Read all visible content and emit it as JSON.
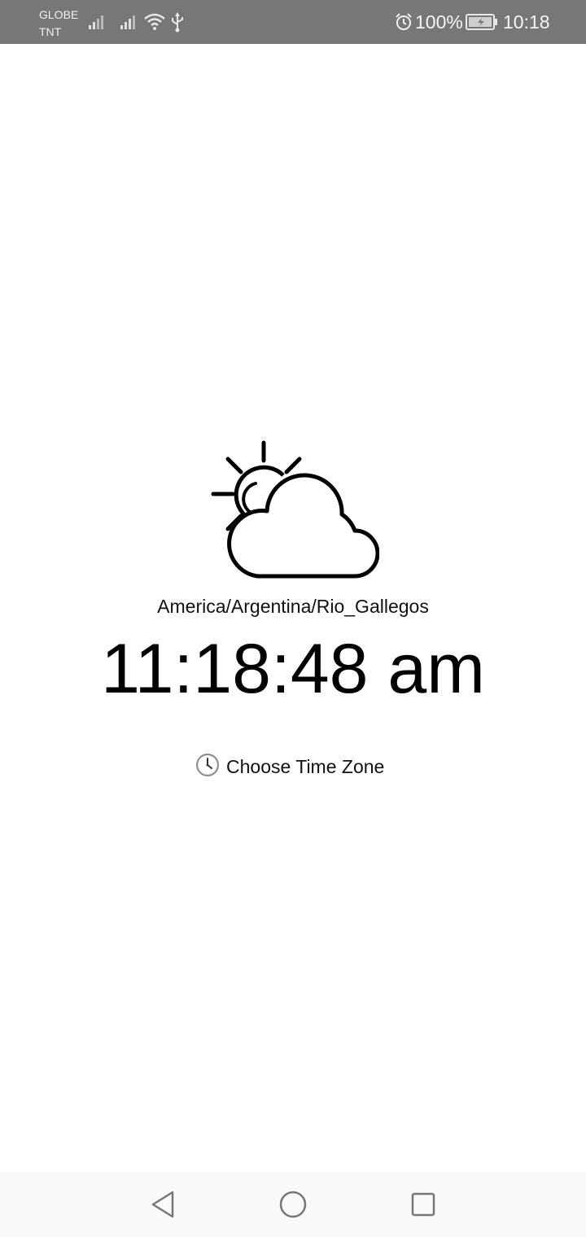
{
  "status_bar": {
    "carrier_line1": "GLOBE",
    "carrier_line2": "TNT",
    "icons": [
      "signal-icon",
      "signal-icon",
      "wifi-icon",
      "usb-icon",
      "alarm-icon",
      "battery-icon"
    ],
    "battery_percent": "100%",
    "clock": "10:18"
  },
  "main": {
    "weather_icon": "partly-cloudy-icon",
    "timezone": "America/Argentina/Rio_Gallegos",
    "time": "11:18:48 am",
    "choose_button": {
      "icon": "clock-icon",
      "label": "Choose Time Zone"
    }
  },
  "nav_bar": {
    "icons": [
      "back-icon",
      "home-icon",
      "recents-icon"
    ]
  },
  "colors": {
    "status_bar_bg": "#777777",
    "background": "#ffffff",
    "text": "#000000"
  }
}
